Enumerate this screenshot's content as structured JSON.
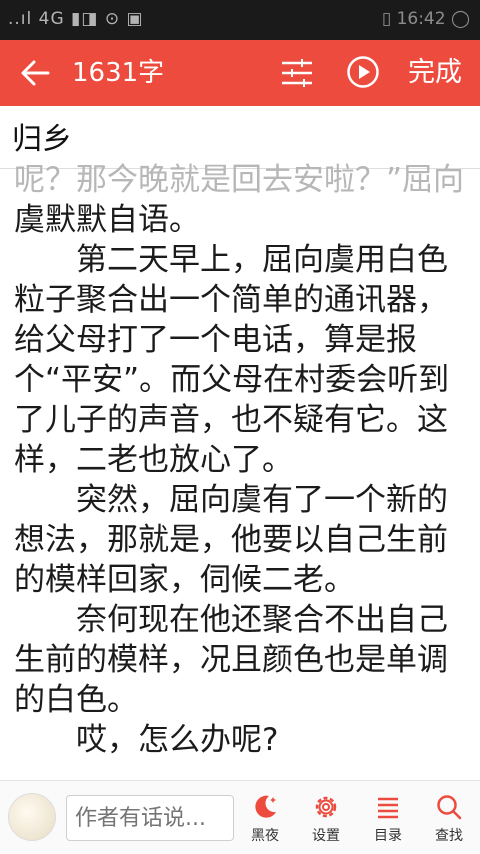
{
  "status_bar": {
    "left": "..ıl 4G ▮◨ ⊙ ▣",
    "right": "▯ 16:42 ◯"
  },
  "header": {
    "word_count": "1631字",
    "done_label": "完成",
    "accent": "#ec4b3e"
  },
  "chapter_title": "归乡",
  "paragraphs": [
    {
      "text": "呢？那今晚就是回去安啦？”屈向",
      "style": "faded"
    },
    {
      "text": "虞默默自语。",
      "style": "normal"
    },
    {
      "text": "　　第二天早上，屈向虞用白色粒子聚合出一个简单的通讯器，给父母打了一个电话，算是报个“平安”。而父母在村委会听到了儿子的声音，也不疑有它。这样，二老也放心了。",
      "style": "normal"
    },
    {
      "text": "　　突然，屈向虞有了一个新的想法，那就是，他要以自己生前的模样回家，伺候二老。",
      "style": "normal"
    },
    {
      "text": "　　奈何现在他还聚合不出自己生前的模样，况且颜色也是单调的白色。",
      "style": "normal"
    },
    {
      "text": "　　哎，怎么办呢?",
      "style": "normal"
    }
  ],
  "toolbar": {
    "note_placeholder": "作者有话说...",
    "night_label": "黑夜",
    "settings_label": "设置",
    "toc_label": "目录",
    "search_label": "查找"
  }
}
